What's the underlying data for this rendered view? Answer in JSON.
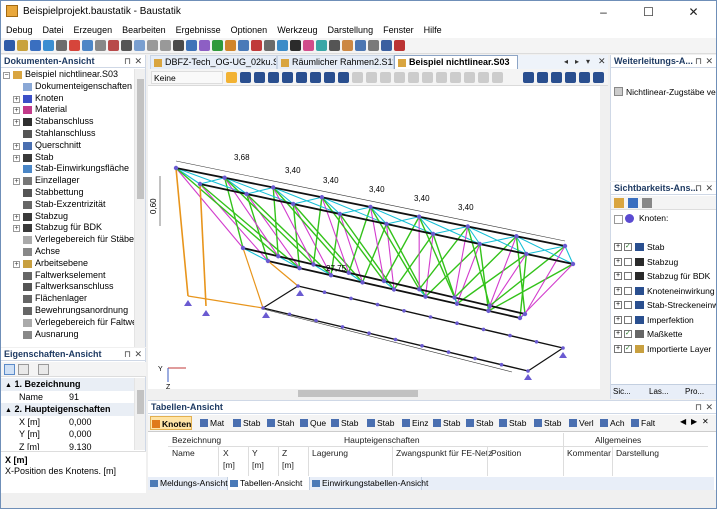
{
  "window": {
    "title": "Beispielprojekt.baustatik - Baustatik",
    "controls": [
      "–",
      "☐",
      "✕"
    ]
  },
  "menu": [
    "Debug",
    "Datei",
    "Erzeugen",
    "Bearbeiten",
    "Ergebnisse",
    "Optionen",
    "Werkzeug",
    "Darstellung",
    "Fenster",
    "Hilfe"
  ],
  "doc_panel": {
    "title": "Dokumenten-Ansicht",
    "root": "Beispiel nichtlinear.S03",
    "items": [
      {
        "label": "Dokumenteigenschaften",
        "icon": "document-icon",
        "exp": false
      },
      {
        "label": "Knoten",
        "icon": "node-icon",
        "exp": true
      },
      {
        "label": "Material",
        "icon": "material-icon",
        "exp": true
      },
      {
        "label": "Stabanschluss",
        "icon": "member-release-icon",
        "exp": true
      },
      {
        "label": "Stahlanschluss",
        "icon": "steel-connection-icon",
        "exp": false
      },
      {
        "label": "Querschnitt",
        "icon": "cross-section-icon",
        "exp": true
      },
      {
        "label": "Stab",
        "icon": "member-icon",
        "exp": true
      },
      {
        "label": "Stab-Einwirkungsfläche",
        "icon": "load-area-icon",
        "exp": false
      },
      {
        "label": "Einzellager",
        "icon": "support-icon",
        "exp": true
      },
      {
        "label": "Stabbettung",
        "icon": "bedding-icon",
        "exp": false
      },
      {
        "label": "Stab-Exzentrizität",
        "icon": "eccentricity-icon",
        "exp": false
      },
      {
        "label": "Stabzug",
        "icon": "member-chain-icon",
        "exp": true
      },
      {
        "label": "Stabzug für BDK",
        "icon": "member-chain-icon",
        "exp": true
      },
      {
        "label": "Verlegebereich für Stäbe/l",
        "icon": "layout-area-icon",
        "exp": false
      },
      {
        "label": "Achse",
        "icon": "axis-icon",
        "exp": false
      },
      {
        "label": "Arbeitsebene",
        "icon": "work-plane-icon",
        "exp": true
      },
      {
        "label": "Faltwerkselement",
        "icon": "plate-icon",
        "exp": false
      },
      {
        "label": "Faltwerksanschluss",
        "icon": "plate-connection-icon",
        "exp": false
      },
      {
        "label": "Flächenlager",
        "icon": "surface-support-icon",
        "exp": false
      },
      {
        "label": "Bewehrungsanordnung",
        "icon": "reinforcement-icon",
        "exp": false
      },
      {
        "label": "Verlegebereich für Faltwer",
        "icon": "layout-area-icon",
        "exp": false
      },
      {
        "label": "Ausnarung",
        "icon": "opening-icon",
        "exp": false
      }
    ]
  },
  "props_panel": {
    "title": "Eigenschaften-Ansicht",
    "sections": [
      {
        "label": "1. Bezeichnung"
      },
      {
        "label": "2. Haupteigenschaften"
      }
    ],
    "rows": [
      {
        "name": "Name",
        "value": "91"
      },
      {
        "name": "X [m]",
        "value": "0,000"
      },
      {
        "name": "Y [m]",
        "value": "0,000"
      },
      {
        "name": "Z [m]",
        "value": "9,130"
      }
    ],
    "desc_title": "X [m]",
    "desc_text": "X-Position des Knotens. [m]"
  },
  "doc_tabs": [
    {
      "label": "DBFZ-Tech_OG-UG_02ku.S03",
      "active": false
    },
    {
      "label": "Räumlicher Rahmen2.S11",
      "active": false
    },
    {
      "label": "Beispiel nichtlinear.S03",
      "active": true
    }
  ],
  "view_toolbar": {
    "work_plane": "Keine Arbeitseben"
  },
  "dimensions": {
    "top": [
      "3,68",
      "3,40",
      "3,40",
      "3,40",
      "3,40",
      "3,40"
    ],
    "total": "27,75",
    "height": "0,60"
  },
  "axis_labels": {
    "y": "Y",
    "z": "Z"
  },
  "weiter_panel": {
    "title": "Weiterleitungs-A...",
    "item": "Nichtlinear-Zugstäbe verst"
  },
  "vis_panel": {
    "title": "Sichtbarkeits-Ans...",
    "header": "Knoten",
    "items": [
      {
        "label": "Stab",
        "checked": true
      },
      {
        "label": "Stabzug",
        "checked": false
      },
      {
        "label": "Stabzug für BDK",
        "checked": false
      },
      {
        "label": "Knoteneinwirkung",
        "checked": false
      },
      {
        "label": "Stab-Streckeneinwirk",
        "checked": false
      },
      {
        "label": "Imperfektion",
        "checked": false
      },
      {
        "label": "Maßkette",
        "checked": true
      },
      {
        "label": "Importierte Layer",
        "checked": true
      }
    ],
    "bottom_tabs": [
      "Sic...",
      "Las...",
      "Pro..."
    ]
  },
  "table_panel": {
    "title": "Tabellen-Ansicht",
    "tabs": [
      "Knoten",
      "Mat",
      "Stab",
      "Stah",
      "Que",
      "Stab",
      "Stab",
      "Einz",
      "Stab",
      "Stab",
      "Stab",
      "Stab",
      "Verl",
      "Ach",
      "Falt"
    ],
    "groups": {
      "haupt": "Haupteigenschaften",
      "allg": "Allgemeines"
    },
    "columns": {
      "bez": "Bezeichnung",
      "name": "Name",
      "x": "X",
      "xu": "[m]",
      "y": "Y",
      "yu": "[m]",
      "z": "Z",
      "zu": "[m]",
      "lagerung": "Lagerung",
      "zwang": "Zwangspunkt für FE-Netz",
      "position": "Position",
      "kommentar": "Kommentar",
      "darstellung": "Darstellung"
    }
  },
  "bottom_tabs": [
    "Meldungs-Ansicht",
    "Tabellen-Ansicht",
    "Einwirkungstabellen-Ansicht"
  ],
  "colors": {
    "chord": "#111111",
    "diag_green": "#33c21a",
    "diag_cyan": "#16bfd6",
    "magenta": "#d23ccd",
    "orange": "#e8951c",
    "node": "#6a5ad1"
  }
}
